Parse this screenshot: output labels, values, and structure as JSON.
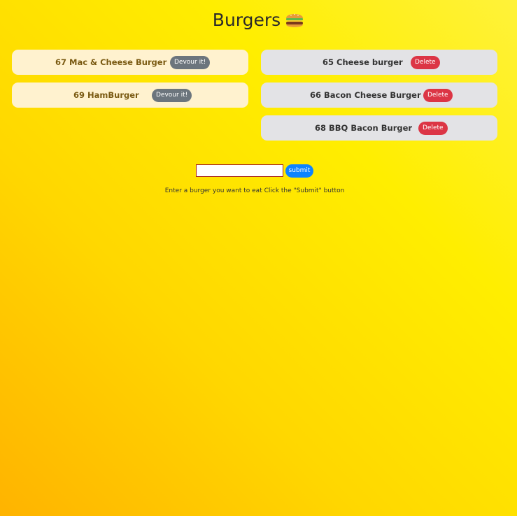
{
  "page": {
    "title": "Burgers",
    "title_icon": "hamburger-icon"
  },
  "uneaten_burgers": [
    {
      "label": "67 Mac & Cheese Burger",
      "button": "Devour it!"
    },
    {
      "label": "69 HamBurger",
      "button": "Devour it!"
    }
  ],
  "devoured_burgers": [
    {
      "label": "65 Cheese burger",
      "button": "Delete"
    },
    {
      "label": "66 Bacon Cheese Burger",
      "button": "Delete"
    },
    {
      "label": "68 BBQ Bacon Burger",
      "button": "Delete"
    }
  ],
  "form": {
    "input_value": "",
    "submit_label": "submit",
    "instructions": "Enter a burger you want to eat Click the \"Submit\" button"
  },
  "colors": {
    "background": "#ffe600",
    "uneaten_card": "#fff2cf",
    "eaten_card": "#e3e3e6",
    "devour_button": "#6c757d",
    "delete_button": "#dc3545",
    "submit_button": "#0d84ff"
  }
}
